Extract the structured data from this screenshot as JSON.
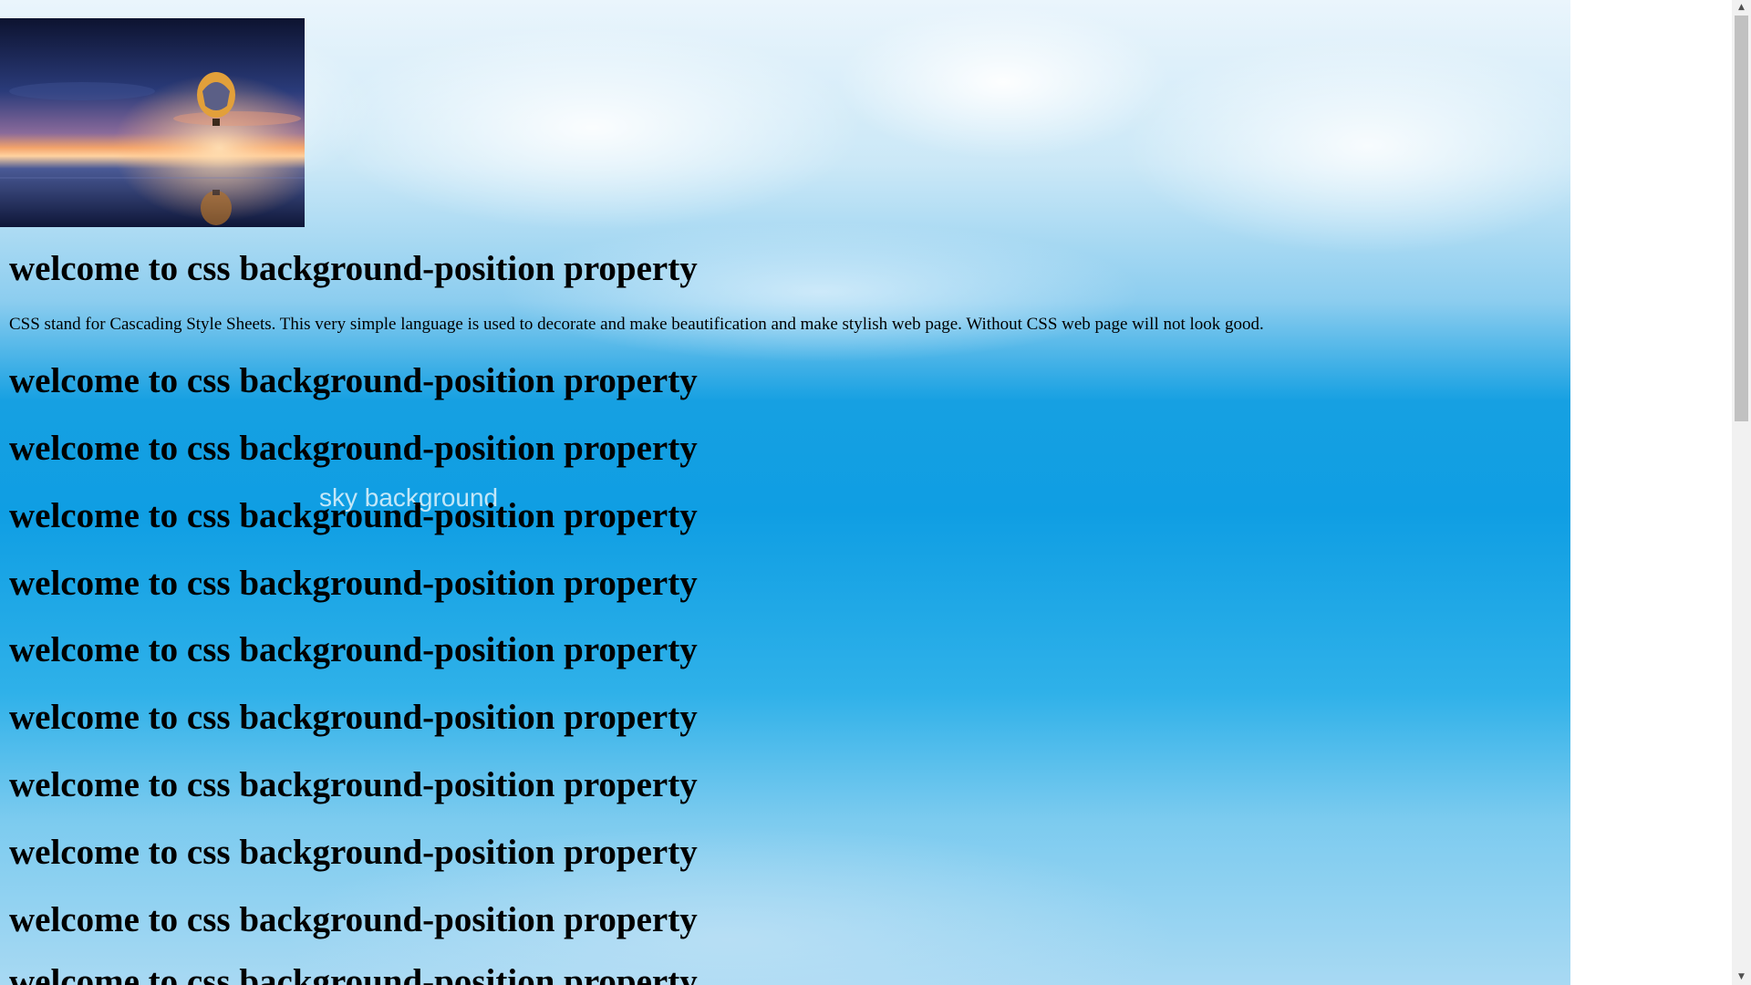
{
  "page": {
    "heading_text": "welcome to css background-position property",
    "paragraph_text": "CSS stand for Cascading Style Sheets. This very simple language is used to decorate and make beautification and make stylish web page. Without CSS web page will not look good.",
    "headings": [
      "welcome to css background-position property",
      "welcome to css background-position property",
      "welcome to css background-position property",
      "welcome to css background-position property",
      "welcome to css background-position property",
      "welcome to css background-position property",
      "welcome to css background-position property",
      "welcome to css background-position property",
      "welcome to css background-position property",
      "welcome to css background-position property",
      "welcome to css background-position property"
    ]
  },
  "background_image": {
    "overlay_text": "sky background"
  },
  "colors": {
    "sky_top": "#eaf5fc",
    "sky_mid": "#0f9ee3",
    "sky_bottom": "#a8d9f3",
    "page_background": "#ffffff",
    "scrollbar_thumb": "#c1c1c1"
  },
  "scrollbar": {
    "up_arrow": "▲",
    "down_arrow": "▼"
  }
}
